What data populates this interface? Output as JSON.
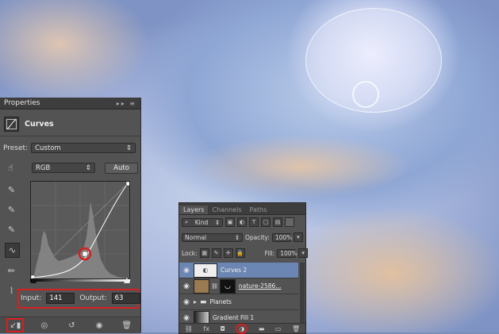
{
  "properties": {
    "title": "Properties",
    "header_label": "Curves",
    "preset_label": "Preset:",
    "preset_value": "Custom",
    "channel_value": "RGB",
    "auto_label": "Auto",
    "input_label": "Input:",
    "input_value": "141",
    "output_label": "Output:",
    "output_value": "63"
  },
  "layers": {
    "tabs": [
      "Layers",
      "Channels",
      "Paths"
    ],
    "kind_label": "Kind",
    "blend_mode": "Normal",
    "opacity_label": "Opacity:",
    "opacity_value": "100%",
    "lock_label": "Lock:",
    "fill_label": "Fill:",
    "fill_value": "100%",
    "items": [
      {
        "name": "Curves 2"
      },
      {
        "name": "nature-2586..."
      },
      {
        "name": "Planets"
      },
      {
        "name": "Gradient Fill 1"
      }
    ]
  },
  "colors": {
    "highlight": "#d62020",
    "selected_layer": "#6b86b3"
  }
}
